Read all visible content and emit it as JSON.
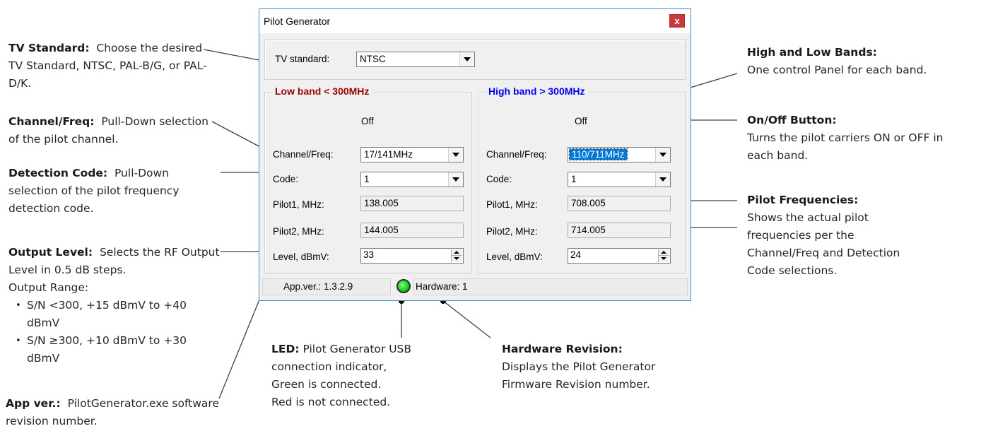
{
  "dialog": {
    "title": "Pilot Generator",
    "close_label": "x",
    "tv_standard_label": "TV standard:",
    "tv_standard_value": "NTSC",
    "low_band": {
      "title": "Low band < 300MHz",
      "title_color": "#9b0000",
      "status": "Off",
      "channel_label": "Channel/Freq:",
      "channel_value": "17/141MHz",
      "code_label": "Code:",
      "code_value": "1",
      "pilot1_label": "Pilot1, MHz:",
      "pilot1_value": "138.005",
      "pilot2_label": "Pilot2, MHz:",
      "pilot2_value": "144.005",
      "level_label": "Level, dBmV:",
      "level_value": "33"
    },
    "high_band": {
      "title": "High band > 300MHz",
      "title_color": "#0000ee",
      "status": "Off",
      "channel_label": "Channel/Freq:",
      "channel_value": "110/711MHz",
      "code_label": "Code:",
      "code_value": "1",
      "pilot1_label": "Pilot1, MHz:",
      "pilot1_value": "708.005",
      "pilot2_label": "Pilot2, MHz:",
      "pilot2_value": "714.005",
      "level_label": "Level, dBmV:",
      "level_value": "24"
    },
    "status_bar": {
      "app_version": "App.ver.: 1.3.2.9",
      "led_color": "#16d416",
      "hardware": "Hardware: 1"
    }
  },
  "annotations": {
    "tv_standard": {
      "heading": "TV Standard:",
      "text": "Choose the desired TV Standard, NTSC, PAL-B/G, or PAL-D/K."
    },
    "channel_freq": {
      "heading": "Channel/Freq:",
      "text": "Pull-Down selection of the pilot channel."
    },
    "detection_code": {
      "heading": "Detection Code:",
      "text": "Pull-Down selection of the pilot frequency detection code."
    },
    "output_level": {
      "heading": "Output Level:",
      "text": "Selects the RF Output Level in 0.5 dB steps.",
      "range_label": "Output Range:",
      "bullets": [
        "S/N <300, +15 dBmV to +40 dBmV",
        "S/N ≥300, +10 dBmV to +30 dBmV"
      ]
    },
    "app_ver": {
      "heading": "App ver.:",
      "text": "PilotGenerator.exe software revision number."
    },
    "led": {
      "heading": "LED:",
      "text": "Pilot Generator USB connection indicator,",
      "line2": "Green is connected.",
      "line3": "Red is not connected."
    },
    "hardware_revision": {
      "heading": "Hardware Revision:",
      "text": "Displays the Pilot Generator Firmware Revision number."
    },
    "high_low_bands": {
      "heading": "High and Low Bands:",
      "text": "One control Panel for each band."
    },
    "on_off": {
      "heading": "On/Off Button:",
      "text": "Turns the pilot carriers ON or OFF in each band."
    },
    "pilot_frequencies": {
      "heading": "Pilot Frequencies:",
      "text": "Shows the actual pilot frequencies per the Channel/Freq and Detection Code selections."
    }
  }
}
